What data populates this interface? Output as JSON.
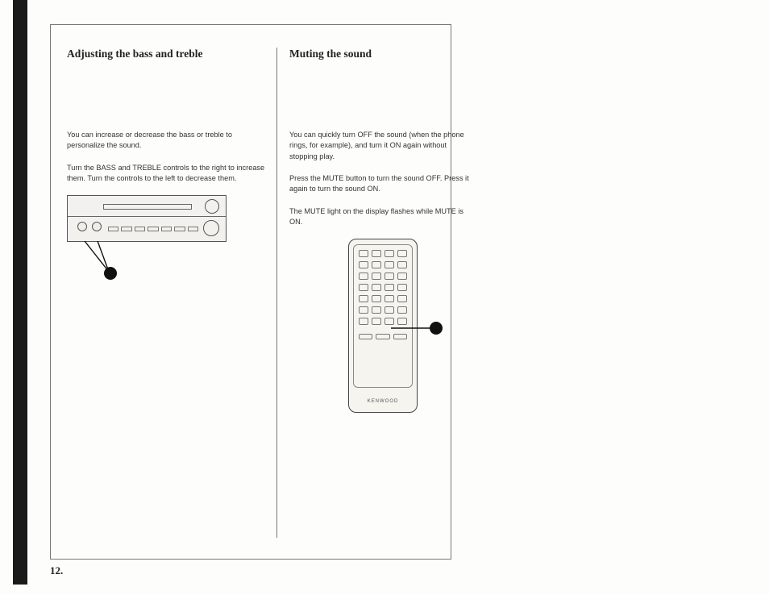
{
  "page_number": "12.",
  "left": {
    "heading": "Adjusting the bass and treble",
    "p1": "You can increase or decrease the bass or treble to personalize the sound.",
    "p2": "Turn the BASS and TREBLE controls to the right to increase them. Turn the controls to the left to decrease them."
  },
  "right": {
    "heading": "Muting the sound",
    "p1": "You can quickly turn OFF the sound (when the phone rings, for example), and turn it ON again without stopping play.",
    "p2": "Press the MUTE button to turn the sound OFF. Press it again to turn the sound ON.",
    "p3": "The MUTE light on the display flashes while MUTE is ON."
  },
  "remote_brand": "KENWOOD"
}
